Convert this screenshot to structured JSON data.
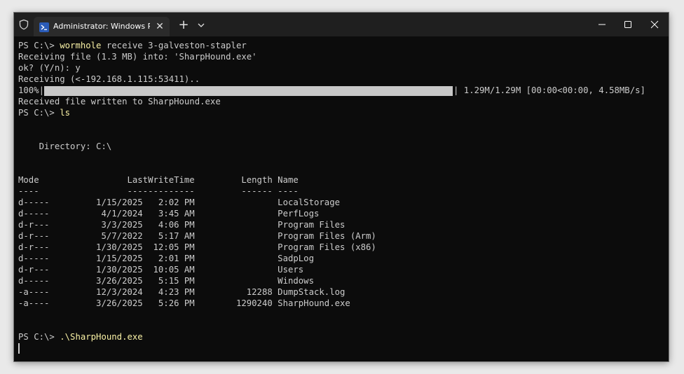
{
  "tab": {
    "title": "Administrator: Windows PowerShell",
    "close_glyph": "✕"
  },
  "titlebar": {
    "new_tab_glyph": "+"
  },
  "terminal": {
    "prompt": "PS C:\\> ",
    "cmd1": "wormhole",
    "cmd1_args": " receive 3-galveston-stapler",
    "line_receiving_file": "Receiving file (1.3 MB) into: 'SharpHound.exe'",
    "line_ok": "ok? (Y/n): y",
    "line_receiving": "Receiving (<-192.168.1.115:53411)..",
    "progress_prefix": "100%|",
    "progress_suffix": "| 1.29M/1.29M [00:00<00:00, 4.58MB/s]",
    "progress_fraction": 1.0,
    "line_written": "Received file written to SharpHound.exe",
    "cmd2": "ls",
    "directory_line": "    Directory: C:\\",
    "header": "Mode                 LastWriteTime         Length Name",
    "underline": "----                 -------------         ------ ----",
    "rows": [
      "d-----         1/15/2025   2:02 PM                LocalStorage",
      "d-----          4/1/2024   3:45 AM                PerfLogs",
      "d-r---          3/3/2025   4:06 PM                Program Files",
      "d-r---          5/7/2022   5:17 AM                Program Files (Arm)",
      "d-r---         1/30/2025  12:05 PM                Program Files (x86)",
      "d-----         1/15/2025   2:01 PM                SadpLog",
      "d-r---         1/30/2025  10:05 AM                Users",
      "d-----         3/26/2025   5:15 PM                Windows",
      "-a----         12/3/2024   4:23 PM          12288 DumpStack.log",
      "-a----         3/26/2025   5:26 PM        1290240 SharpHound.exe"
    ],
    "cmd3": ".\\SharpHound.exe"
  },
  "icons": {
    "shield": "shield-icon",
    "powershell": "powershell-icon",
    "dropdown": "chevron-down-icon",
    "minimize": "minimize-icon",
    "maximize": "maximize-icon",
    "close": "close-icon"
  },
  "colors": {
    "terminal_bg": "#0c0c0c",
    "terminal_fg": "#cccccc",
    "command": "#f9f1a5",
    "titlebar": "#1f1f1f",
    "tab": "#2b2b2b"
  }
}
